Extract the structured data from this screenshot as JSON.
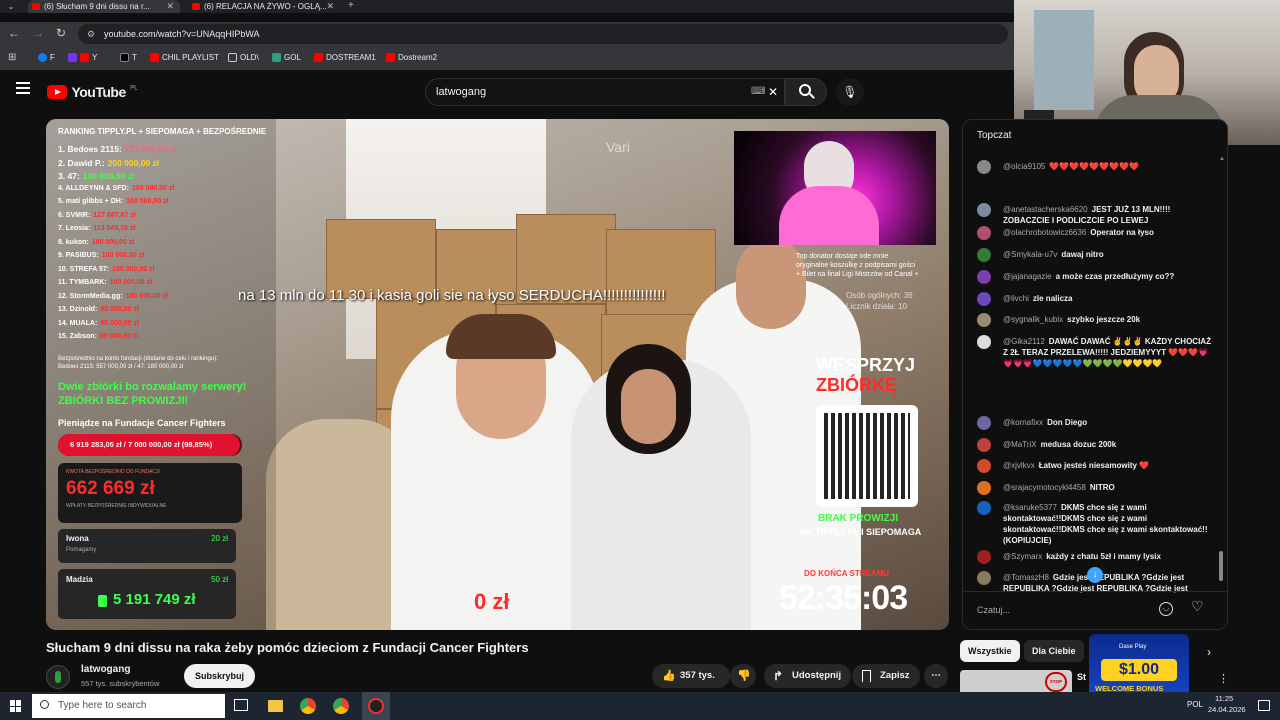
{
  "tabs": [
    {
      "label": "(6) Słucham 9 dni dissu na r..."
    },
    {
      "label": "(6) RELACJA NA ŻYWO - OGLĄ..."
    }
  ],
  "address": {
    "url": "youtube.com/watch?v=UNAqqHIPbWA"
  },
  "bookmarks": [
    {
      "label": "F"
    },
    {
      "label": "Y"
    },
    {
      "label": "T"
    },
    {
      "label": "CHIL PLAYLIST"
    },
    {
      "label": "OLD\\"
    },
    {
      "label": "GOL"
    },
    {
      "label": "DOSTREAM1"
    },
    {
      "label": "Dostream2"
    }
  ],
  "youtube": {
    "logo": "YouTube",
    "region": "PL",
    "search_value": "latwogang"
  },
  "overlay": {
    "ranking_title": "RANKING TIPPLY.PL + SIEPOMAGA + BEZPOŚREDNIE",
    "ranking": [
      {
        "name": "1. Bedoes 2115:",
        "value": "717 267,66 zł"
      },
      {
        "name": "2. Dawid P.:",
        "value": "200 000,00 zł"
      },
      {
        "name": "3. 47:",
        "value": "180 000,00 zł"
      },
      {
        "name": "4. ALLDEYNN & SFD:",
        "value": "150 000,00 zł"
      },
      {
        "name": "5. mati glibbs + DH:",
        "value": "100 000,00 zł"
      },
      {
        "name": "6. SVMIR:",
        "value": "127 887,67 zł"
      },
      {
        "name": "7. Leosia:",
        "value": "113 049,10 zł"
      },
      {
        "name": "8. kukon:",
        "value": "100 000,00 zł"
      },
      {
        "name": "9. PASIBUS:",
        "value": "100 000,00 zł"
      },
      {
        "name": "10. STREFA 57:",
        "value": "100 000,00 zł"
      },
      {
        "name": "11. TYMBARK:",
        "value": "100 000,00 zł"
      },
      {
        "name": "12. StormMedia.gg:",
        "value": "100 000,00 zł"
      },
      {
        "name": "13. Dzinold:",
        "value": "95 000,00 zł"
      },
      {
        "name": "14. MUALA:",
        "value": "86 000,00 zł"
      },
      {
        "name": "15. Zabson:",
        "value": "80 000,00 zł"
      }
    ],
    "ranking_note": "Bezpośrednio na konto fundacji (dodane do celu i rankingu):",
    "ranking_note2": "Bedoes 2115: 557 000,00 zł / 47: 180 000,00 zł",
    "green_line1": "Dwie zbiórki bo rozwalamy serwery!",
    "green_line2": "ZBIÓRKI BEZ PROWIZJI!",
    "fund_title": "Pieniądze na Fundacje Cancer Fighters",
    "progress_text": "6 919 283,05 zł / 7 000 000,00 zł (98,85%)",
    "progress_fraction": 0.9885,
    "direct_label": "KWOTA BEZPOŚREDNIO DO FUNDACJI",
    "direct_amount": "662 669 zł",
    "direct_sub": "WPŁATY BEZPOŚREDNIE INDYWIDUALNE",
    "donor1_name": "Iwona",
    "donor1_amount": "20 zł",
    "donor1_sub": "Pomagamy",
    "donor2_name": "Madzia",
    "donor2_amount": "50 zł",
    "total_amount": "5 191 749 zł",
    "caption": "na 13 mln do 11 30 i kasia goli sie na łyso SERDUCHA!!!!!!!!!!!!!!!",
    "top_donor_note1": "Top donator dostaje ode mnie",
    "top_donor_note2": "oryginalne koszulkę z podpisami gości",
    "top_donor_note3": "+ Bilet na finał Ligi Mistrzów od Canal +",
    "viewers1": "Osób ogólnych: 36",
    "viewers2": "Licznik działa: 10",
    "wesprzyj1": "WESPRZYJ",
    "wesprzyj2": "ZBIÓRKĘ",
    "brak1": "BRAK PROWIZJI",
    "brak2": "NA TIPPLY.PL I SIEPOMAGA",
    "do_konca": "DO KOŃCA STREAMU",
    "timer": "52:35:03",
    "zero": "0 zł",
    "watermark": "Vari"
  },
  "chat": {
    "header": "Topczat",
    "input_placeholder": "Czatuj...",
    "messages": [
      {
        "user": "@olcia9105",
        "text": "❤️❤️❤️❤️❤️❤️❤️❤️❤️",
        "color": "#888"
      },
      {
        "user": "@anetastacherska6620",
        "text": "JEST JUŻ 13 MLN!!!! ZOBACZCIE I PODLICZCIE PO LEWEJ",
        "color": "#7a8aa0"
      },
      {
        "user": "@olachrobotowicz6636",
        "text": "Operator na łyso",
        "color": "#b05070"
      },
      {
        "user": "@Smykala-u7v",
        "text": "dawaj nitro",
        "color": "#2e7d32"
      },
      {
        "user": "@jajanagazie",
        "text": "a może czas przedłużymy co??",
        "color": "#7b3fb0"
      },
      {
        "user": "@livchi",
        "text": "zle nalicza",
        "color": "#6a4ab8"
      },
      {
        "user": "@sygnalik_kubix",
        "text": "szybko jeszcze 20k",
        "color": "#9a8a70"
      },
      {
        "user": "@Gika2112",
        "text": "DAWAĆ DAWAĆ ✌️✌️✌️ KAŻDY CHOCIAŻ Z 2Ł TERAZ PRZELEWA!!!!! JEDZIEMYYYT ❤️❤️❤️💗💗💗💗💙💙💙💙💙💚💚💚💚💛💛💛💛",
        "color": "#ddd"
      },
      {
        "user": "@kornafixx",
        "text": "Don Diego",
        "color": "#6a6aa0"
      },
      {
        "user": "@MaTriX",
        "text": "medusa dozuc 200k",
        "color": "#c04040"
      },
      {
        "user": "@xjvlkvx",
        "text": "Łatwo jesteś niesamowity ❤️",
        "color": "#d04a2a"
      },
      {
        "user": "@srajacymotocykl4458",
        "text": "NITRO",
        "color": "#e07020"
      },
      {
        "user": "@ksaruke5377",
        "text": "DKMS chce się z wami skontaktować!!DKMS chce się z wami skontaktować!!DKMS chce się z wami skontaktować!! (KOPIUJCIE)",
        "color": "#1565c0"
      },
      {
        "user": "@Szymarx",
        "text": "każdy z chatu 5zł i mamy lysix",
        "color": "#a02020"
      },
      {
        "user": "@TomaszH8",
        "text": "Gdzie jest REPUBLIKA ?Gdzie jest REPUBLIKA ?Gdzie jest REPUBLIKA ?Gdzie jest",
        "color": "#8a7a60"
      }
    ]
  },
  "video_meta": {
    "title": "Słucham 9 dni dissu na raka żeby pomóc dzieciom z Fundacji Cancer Fighters",
    "channel": "latwogang",
    "subscribers": "557 tys. subskrybentów",
    "subscribe_label": "Subskrybuj",
    "likes": "357 tys.",
    "share_label": "Udostępnij",
    "save_label": "Zapisz"
  },
  "filters": {
    "all": "Wszystkie",
    "for_you": "Dla Ciebie",
    "stop": "STOP CHAT",
    "st": "St"
  },
  "ad": {
    "brand": "Dase Play",
    "amount": "$1.00",
    "caption": "WELCOME BONUS"
  },
  "taskbar": {
    "search_placeholder": "Type here to search",
    "time": "11:25",
    "date": "24.04.2026",
    "lang": "POL"
  },
  "colors": {
    "yt_red": "#ff0000",
    "green_overlay": "#3dff4a",
    "red_amount": "#ff2b2b"
  }
}
